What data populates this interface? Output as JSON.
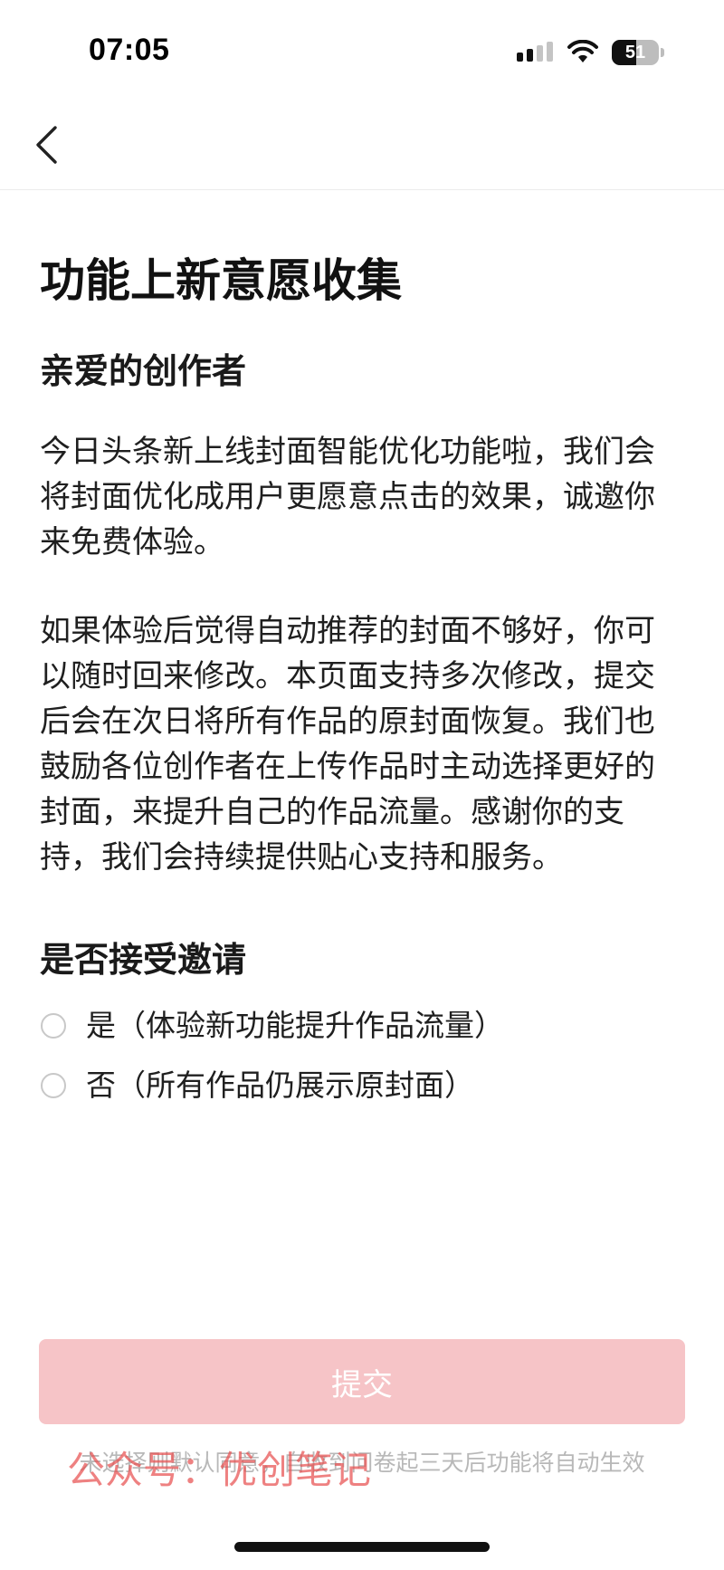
{
  "status_bar": {
    "time": "07:05",
    "battery_level": "51",
    "icons": [
      "signal-icon",
      "wifi-icon",
      "battery-icon"
    ]
  },
  "nav": {
    "back_icon": "chevron-left-icon"
  },
  "page": {
    "title": "功能上新意愿收集",
    "greeting": "亲爱的创作者",
    "paragraph_1": "今日头条新上线封面智能优化功能啦，我们会将封面优化成用户更愿意点击的效果，诚邀你来免费体验。",
    "paragraph_2": "如果体验后觉得自动推荐的封面不够好，你可以随时回来修改。本页面支持多次修改，提交后会在次日将所有作品的原封面恢复。我们也鼓励各位创作者在上传作品时主动选择更好的封面，来提升自己的作品流量。感谢你的支持，我们会持续提供贴心支持和服务。",
    "question": "是否接受邀请",
    "options": [
      {
        "label": "是（体验新功能提升作品流量）",
        "selected": false
      },
      {
        "label": "否（所有作品仍展示原封面）",
        "selected": false
      }
    ]
  },
  "submit": {
    "label": "提交",
    "disabled": true
  },
  "footer_note": "未选择则默认同意，自收到问卷起三天后功能将自动生效",
  "watermark": "公众号：优创笔记",
  "colors": {
    "submit_bg": "#f6c4c7",
    "watermark": "#e85050",
    "footer_text": "#b8b8b8",
    "radio_border": "#c8c8c8"
  }
}
